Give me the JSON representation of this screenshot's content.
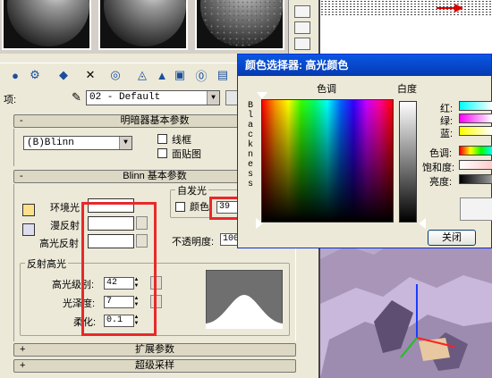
{
  "material_editor": {
    "material_label": "项:",
    "material_name": "02 - Default",
    "shader_rollout_title": "明暗器基本参数",
    "shader_type": "(B)Blinn",
    "wire_label": "线框",
    "facemap_label": "面贴图",
    "blinn_rollout_title": "Blinn 基本参数",
    "self_illum_title": "自发光",
    "self_illum_color_label": "颜色",
    "self_illum_value": "39",
    "ambient_label": "环境光",
    "diffuse_label": "漫反射",
    "specular_label": "高光反射",
    "opacity_label": "不透明度:",
    "opacity_value": "100",
    "spec_highlights_title": "反射高光",
    "spec_level_label": "高光级别:",
    "spec_level_value": "42",
    "glossiness_label": "光泽度:",
    "glossiness_value": "7",
    "soften_label": "柔化:",
    "soften_value": "0.1",
    "ext_rollout_title": "扩展参数",
    "supersampling_rollout_title": "超级采样",
    "rollout_sign_minus": "-",
    "rollout_sign_plus": "+"
  },
  "color_picker": {
    "title": "颜色选择器: 高光颜色",
    "hue_label": "色调",
    "whiteness_label": "白度",
    "blackness_letters": [
      "B",
      "l",
      "a",
      "c",
      "k",
      "n",
      "e",
      "s",
      "s"
    ],
    "red_label": "红:",
    "green_label": "绿:",
    "blue_label": "蓝:",
    "hue_value_label": "色调:",
    "saturation_label": "饱和度:",
    "value_label": "亮度:",
    "close_button": "关闭"
  },
  "colors": {
    "highlight_box": "#e8292b",
    "dialog_title_bg": "#0745c7",
    "viewport_bg": "#b6a8c8"
  }
}
